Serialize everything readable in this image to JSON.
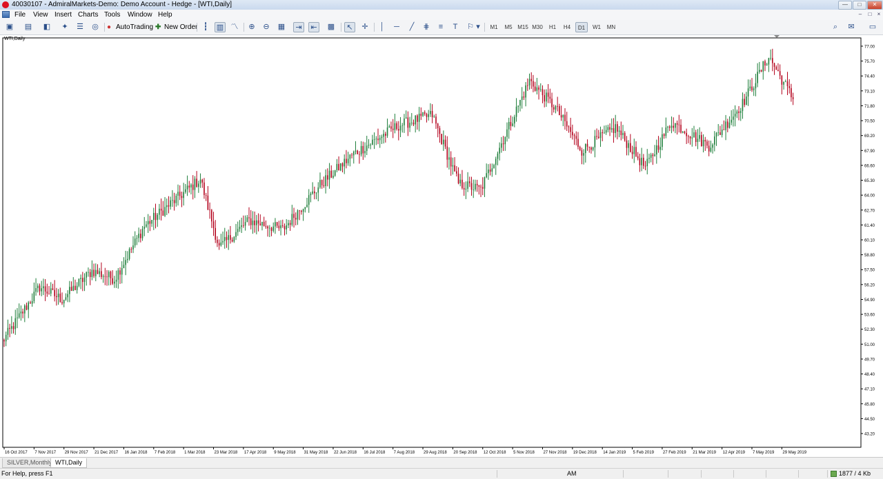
{
  "window": {
    "title": "40030107 - AdmiralMarkets-Demo: Demo Account - Hedge - [WTI,Daily]",
    "controls": [
      "—",
      "□",
      "✕"
    ]
  },
  "menu": {
    "items": [
      "File",
      "View",
      "Insert",
      "Charts",
      "Tools",
      "Window",
      "Help"
    ],
    "mdi_controls": [
      "–",
      "□",
      "×"
    ]
  },
  "toolbar": {
    "autotrading_label": "AutoTrading",
    "new_order_label": "New Order",
    "timeframes": [
      "M1",
      "M5",
      "M15",
      "M30",
      "H1",
      "H4",
      "D1",
      "W1",
      "MN"
    ],
    "active_timeframe": "D1"
  },
  "chart": {
    "symbol_label": "WTI,Daily"
  },
  "chart_data": {
    "type": "candlestick",
    "title": "",
    "ylim": [
      42.0,
      77.6
    ],
    "y_ticks": [
      "77.00",
      "75.70",
      "74.40",
      "73.10",
      "71.80",
      "70.50",
      "69.20",
      "67.90",
      "66.60",
      "65.30",
      "64.00",
      "62.70",
      "61.40",
      "60.10",
      "58.80",
      "57.50",
      "56.20",
      "54.90",
      "53.60",
      "52.30",
      "51.00",
      "49.70",
      "48.40",
      "47.10",
      "45.80",
      "44.50",
      "43.20"
    ],
    "x_ticks": [
      "16 Oct 2017",
      "7 Nov 2017",
      "29 Nov 2017",
      "21 Dec 2017",
      "16 Jan 2018",
      "7 Feb 2018",
      "1 Mar 2018",
      "23 Mar 2018",
      "17 Apr 2018",
      "9 May 2018",
      "31 May 2018",
      "22 Jun 2018",
      "16 Jul 2018",
      "7 Aug 2018",
      "29 Aug 2018",
      "20 Sep 2018",
      "12 Oct 2018",
      "5 Nov 2018",
      "27 Nov 2018",
      "19 Dec 2018",
      "14 Jan 2019",
      "5 Feb 2019",
      "27 Feb 2019",
      "21 Mar 2019",
      "12 Apr 2019",
      "7 May 2019",
      "29 May 2019"
    ],
    "bars_per_tick": 16,
    "bar_count": 423,
    "anchor_closes": [
      {
        "bar": 0,
        "close": 51.2
      },
      {
        "bar": 20,
        "close": 56.0
      },
      {
        "bar": 32,
        "close": 54.9
      },
      {
        "bar": 48,
        "close": 57.4
      },
      {
        "bar": 60,
        "close": 56.7
      },
      {
        "bar": 76,
        "close": 61.3
      },
      {
        "bar": 94,
        "close": 63.8
      },
      {
        "bar": 106,
        "close": 65.4
      },
      {
        "bar": 116,
        "close": 59.4
      },
      {
        "bar": 132,
        "close": 61.8
      },
      {
        "bar": 150,
        "close": 61.0
      },
      {
        "bar": 170,
        "close": 64.9
      },
      {
        "bar": 188,
        "close": 67.6
      },
      {
        "bar": 212,
        "close": 70.1
      },
      {
        "bar": 230,
        "close": 71.0
      },
      {
        "bar": 244,
        "close": 65.0
      },
      {
        "bar": 256,
        "close": 64.5
      },
      {
        "bar": 282,
        "close": 74.0
      },
      {
        "bar": 296,
        "close": 71.6
      },
      {
        "bar": 310,
        "close": 67.9
      },
      {
        "bar": 328,
        "close": 69.9
      },
      {
        "bar": 344,
        "close": 66.4
      },
      {
        "bar": 358,
        "close": 70.4
      },
      {
        "bar": 378,
        "close": 68.3
      },
      {
        "bar": 396,
        "close": 72.0
      },
      {
        "bar": 410,
        "close": 76.1
      },
      {
        "bar": 423,
        "close": 72.4
      }
    ]
  },
  "tabs": [
    {
      "label": "SILVER,Monthly",
      "active": false
    },
    {
      "label": "WTI,Daily",
      "active": true
    }
  ],
  "status": {
    "help": "For Help, press F1",
    "profile": "AM",
    "traffic": "1877 / 4 Kb"
  }
}
